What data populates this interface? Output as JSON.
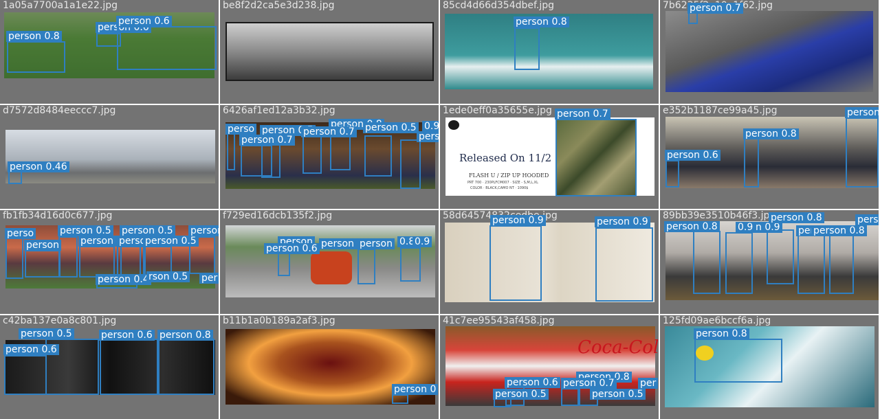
{
  "colors": {
    "box": "#2f7fc1",
    "background": "#737373",
    "filename_text": "#e6e6e6"
  },
  "cells": [
    {
      "filename": "1a05a7700a1a1e22.jpg",
      "labels": [
        "person 0.8",
        "person 0.6",
        "person 0.6"
      ]
    },
    {
      "filename": "be8f2d2ca5e3d238.jpg",
      "labels": []
    },
    {
      "filename": "85cd4d66d354dbef.jpg",
      "labels": [
        "person 0.8"
      ]
    },
    {
      "filename": "7b6235f2e10e1f62.jpg",
      "labels": [
        "person 0.7"
      ]
    },
    {
      "filename": "d7572d8484eeccc7.jpg",
      "labels": [
        "person 0.46"
      ]
    },
    {
      "filename": "6426af1ed12a3b32.jpg",
      "labels": [
        "perso",
        "person 0.5",
        "person 0.8",
        "person 0.7",
        "person 0.5",
        "person 0.5",
        "person 0.7",
        "perso",
        "0.9"
      ]
    },
    {
      "filename": "1ede0eff0a35655e.jpg",
      "labels": [
        "person 0.7"
      ],
      "image_text": {
        "title": "Released On 11/2",
        "sub1": "FLASH U / ZIP UP HOODED",
        "sub2": "PRT 700 · 230PLFCM007 · SIZE - S,M,L,XL",
        "sub3": "COLOR · BLACK,CAMO NT · 1090$"
      }
    },
    {
      "filename": "e352b1187ce99a45.jpg",
      "labels": [
        "person 0.8",
        "person 0.6",
        "person"
      ]
    },
    {
      "filename": "fb1fb34d16d0c677.jpg",
      "labels": [
        "perso",
        "person 0.5",
        "person 0.5",
        "person",
        "person",
        "person 0.5",
        "person 0.5",
        "person 0.5",
        "person 0.4",
        "rson 0.5",
        "per"
      ]
    },
    {
      "filename": "f729ed16dcb135f2.jpg",
      "labels": [
        "person",
        "person 0.6",
        "person 0.6",
        "0.8",
        "person",
        "0.9"
      ]
    },
    {
      "filename": "58d64574832cedbe.jpg",
      "labels": [
        "person 0.9",
        "person 0.9"
      ]
    },
    {
      "filename": "89bb39e3510b46f3.jpg",
      "labels": [
        "person 0.8",
        "0.9",
        "n 0.9",
        "person 0.8",
        "person 0.8",
        "pers",
        "person 0.8"
      ]
    },
    {
      "filename": "c42ba137e0a8c801.jpg",
      "labels": [
        "person 0.5",
        "person 0.6",
        "person 0.8",
        "person 0.6"
      ]
    },
    {
      "filename": "b11b1a0b189a2af3.jpg",
      "labels": [
        "person 0"
      ]
    },
    {
      "filename": "41c7ee95543af458.jpg",
      "labels": [
        "person 0.6",
        "person 0.8",
        "person 0.7",
        "person 0.5",
        "person 0.5",
        "per"
      ],
      "image_text": {
        "brand": "Coca-Cola"
      }
    },
    {
      "filename": "125fd09ae6bccf6a.jpg",
      "labels": [
        "person 0.8"
      ]
    }
  ]
}
